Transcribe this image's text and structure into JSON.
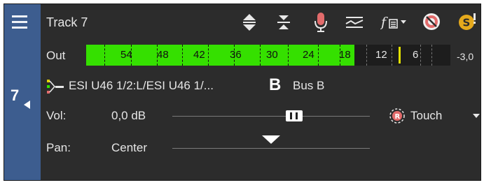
{
  "track": {
    "name": "Track 7",
    "number": "7"
  },
  "meter": {
    "label": "Out",
    "scale_labels": [
      "54",
      "48",
      "42",
      "36",
      "30",
      "24",
      "18",
      "12",
      "6",
      "-3,0"
    ],
    "fill_fraction": 0.737,
    "peak_label": "-3,0",
    "colors": {
      "fill": "#35e000",
      "peak": "#e2e000",
      "background": "#1d1d1d"
    }
  },
  "routing": {
    "output": "ESI U46 1/2:L/ESI U46 1/...",
    "bus_badge": "B",
    "bus_name": "Bus B"
  },
  "volume": {
    "label": "Vol:",
    "value": "0,0 dB"
  },
  "automation": {
    "mode": "Touch"
  },
  "pan": {
    "label": "Pan:",
    "value": "Center"
  },
  "colors": {
    "sidebar": "#3d5d8f",
    "panel": "#2c2c2c",
    "text": "#e6e6e6",
    "record_icon": "#e26b6b",
    "solo_icon": "#e5a91c"
  },
  "icons": {
    "menu": "hamburger-icon",
    "expand": "expand-vertical-icon",
    "collapse": "collapse-vertical-icon",
    "record": "microphone-icon",
    "envelope": "envelope-icon",
    "fx": "fx-icon",
    "mute": "mute-icon",
    "solo": "solo-icon",
    "output": "output-routing-icon",
    "automation": "automation-icon"
  }
}
